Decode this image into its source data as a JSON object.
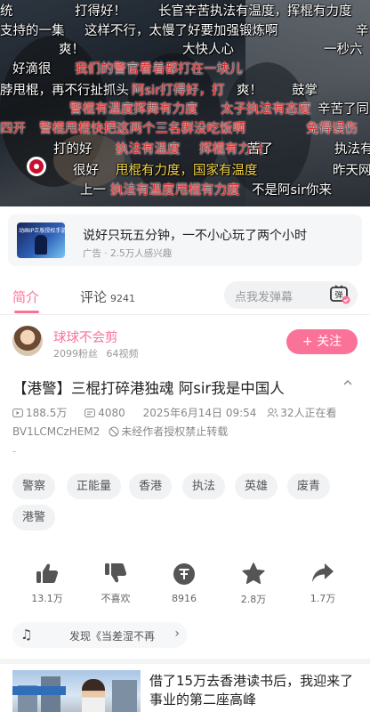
{
  "danmaku": [
    {
      "text": "统",
      "color": "w"
    },
    {
      "text": "打得好！",
      "color": "w"
    },
    {
      "text": "长官辛苦执法有温度，挥棍有力度",
      "color": "w"
    },
    {
      "text": "支持的一集",
      "color": "w"
    },
    {
      "text": "这样不行，太慢了好要加强锻炼啊",
      "color": "w"
    },
    {
      "text": "辛",
      "color": "w"
    },
    {
      "text": "爽！",
      "color": "w"
    },
    {
      "text": "大快人心",
      "color": "w"
    },
    {
      "text": "一秒六",
      "color": "w"
    },
    {
      "text": "好滴很",
      "color": "w"
    },
    {
      "text": "我们的警官看着都打在一块儿",
      "color": "r"
    },
    {
      "text": "脖甩棍，再不行扯抓头",
      "color": "w"
    },
    {
      "text": "阿sir打得好，打",
      "color": "r"
    },
    {
      "text": "爽！",
      "color": "w"
    },
    {
      "text": "鼓掌",
      "color": "w"
    },
    {
      "text": "警棍有温度",
      "color": "r"
    },
    {
      "text": "挥舞有力度",
      "color": "r"
    },
    {
      "text": "太子执法有态度",
      "color": "r"
    },
    {
      "text": "辛苦了同",
      "color": "w"
    },
    {
      "text": "四开",
      "color": "r"
    },
    {
      "text": "警棍甩棍快把这两个三名群没吃饭啊",
      "color": "r"
    },
    {
      "text": "免得误伤",
      "color": "r"
    },
    {
      "text": "打的好",
      "color": "w"
    },
    {
      "text": "执法有温度",
      "color": "r"
    },
    {
      "text": "挥棍有力度",
      "color": "r"
    },
    {
      "text": "苦了",
      "color": "w"
    },
    {
      "text": "执法有",
      "color": "w"
    },
    {
      "text": "很好",
      "color": "w"
    },
    {
      "text": "甩棍有力度，国家有温度",
      "color": "y"
    },
    {
      "text": "昨天网",
      "color": "w"
    },
    {
      "text": "上一",
      "color": "w"
    },
    {
      "text": "执法有温度",
      "color": "r"
    },
    {
      "text": "甩棍有力度",
      "color": "r"
    },
    {
      "text": "不是阿sir你来",
      "color": "w"
    }
  ],
  "ad": {
    "title": "说好只玩五分钟，一不小心玩了两个小时",
    "sub": "广告 · 2.5万人感兴趣",
    "thumb_text": "动画IP正版授权手游"
  },
  "tabs": {
    "intro": "简介",
    "comments": "评论",
    "comment_count": "9241",
    "danmaku_placeholder": "点我发弹幕",
    "danmaku_btn": "弹"
  },
  "uploader": {
    "name": "球球不会剪",
    "fans": "2099粉丝",
    "videos": "64视频",
    "follow": "+ 关注"
  },
  "video": {
    "title": "【港警】三棍打碎港独魂 阿sir我是中国人",
    "views": "188.5万",
    "danmaku_count": "4080",
    "date": "2025年6月14日 09:54",
    "watching": "32人正在看",
    "bvid": "BV1LCMCzHEM2",
    "notice": "未经作者授权禁止转载",
    "desc": "-"
  },
  "tags": [
    "警察",
    "正能量",
    "香港",
    "执法",
    "英雄",
    "废青",
    "港警"
  ],
  "actions": {
    "like": "13.1万",
    "dislike": "不喜欢",
    "coin": "8916",
    "favorite": "2.8万",
    "share": "1.7万"
  },
  "music": {
    "hint": "发现《当差湿不再"
  },
  "recommend": {
    "title": "借了15万去香港读书后，我迎来了事业的第二座高峰"
  },
  "colors": {
    "accent": "#fb7299",
    "danmaku_red": "#e12b2b",
    "danmaku_yellow": "#f6d64a"
  }
}
